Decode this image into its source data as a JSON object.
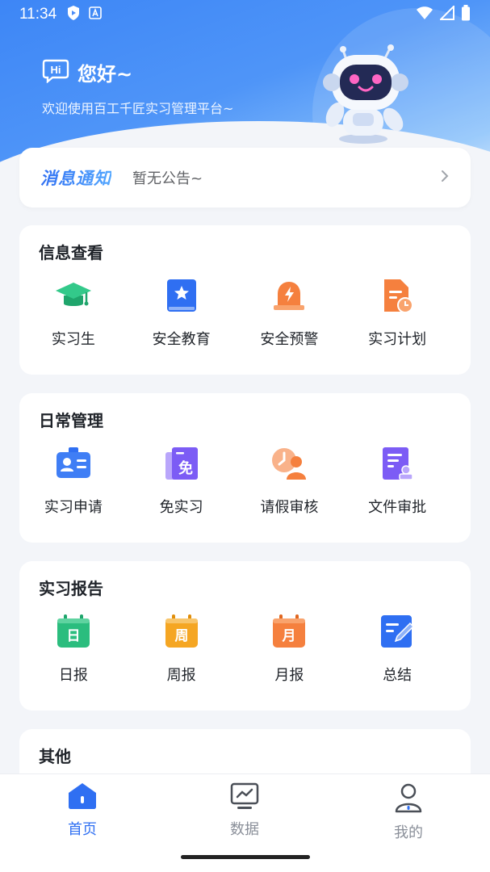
{
  "status_bar": {
    "time": "11:34"
  },
  "greeting": {
    "badge": "Hi",
    "title": "您好~",
    "subtitle": "欢迎使用百工千匠实习管理平台~"
  },
  "notice": {
    "title": "消息通知",
    "text": "暂无公告~"
  },
  "sections": [
    {
      "title": "信息查看",
      "items": [
        {
          "label": "实习生",
          "icon": "graduation-cap-icon"
        },
        {
          "label": "安全教育",
          "icon": "star-book-icon"
        },
        {
          "label": "安全预警",
          "icon": "alarm-light-icon"
        },
        {
          "label": "实习计划",
          "icon": "document-clock-icon"
        }
      ]
    },
    {
      "title": "日常管理",
      "items": [
        {
          "label": "实习申请",
          "icon": "id-card-icon"
        },
        {
          "label": "免实习",
          "icon": "exempt-document-icon",
          "glyph": "免"
        },
        {
          "label": "请假审核",
          "icon": "leave-clock-person-icon"
        },
        {
          "label": "文件审批",
          "icon": "file-approval-icon"
        }
      ]
    },
    {
      "title": "实习报告",
      "items": [
        {
          "label": "日报",
          "icon": "calendar-day-icon",
          "glyph": "日"
        },
        {
          "label": "周报",
          "icon": "calendar-week-icon",
          "glyph": "周"
        },
        {
          "label": "月报",
          "icon": "calendar-month-icon",
          "glyph": "月"
        },
        {
          "label": "总结",
          "icon": "edit-summary-icon"
        }
      ]
    },
    {
      "title": "其他",
      "items": []
    }
  ],
  "tabbar": [
    {
      "label": "首页",
      "icon": "home-icon",
      "active": true
    },
    {
      "label": "数据",
      "icon": "data-monitor-icon",
      "active": false
    },
    {
      "label": "我的",
      "icon": "user-icon",
      "active": false
    }
  ],
  "colors": {
    "accent": "#2f6ff2",
    "header_gradient_start": "#3d86f6",
    "green": "#2bbd7e",
    "blue": "#2f6ff2",
    "orange": "#f5803e",
    "purple": "#7c5cf5",
    "yellow": "#f5a623"
  }
}
